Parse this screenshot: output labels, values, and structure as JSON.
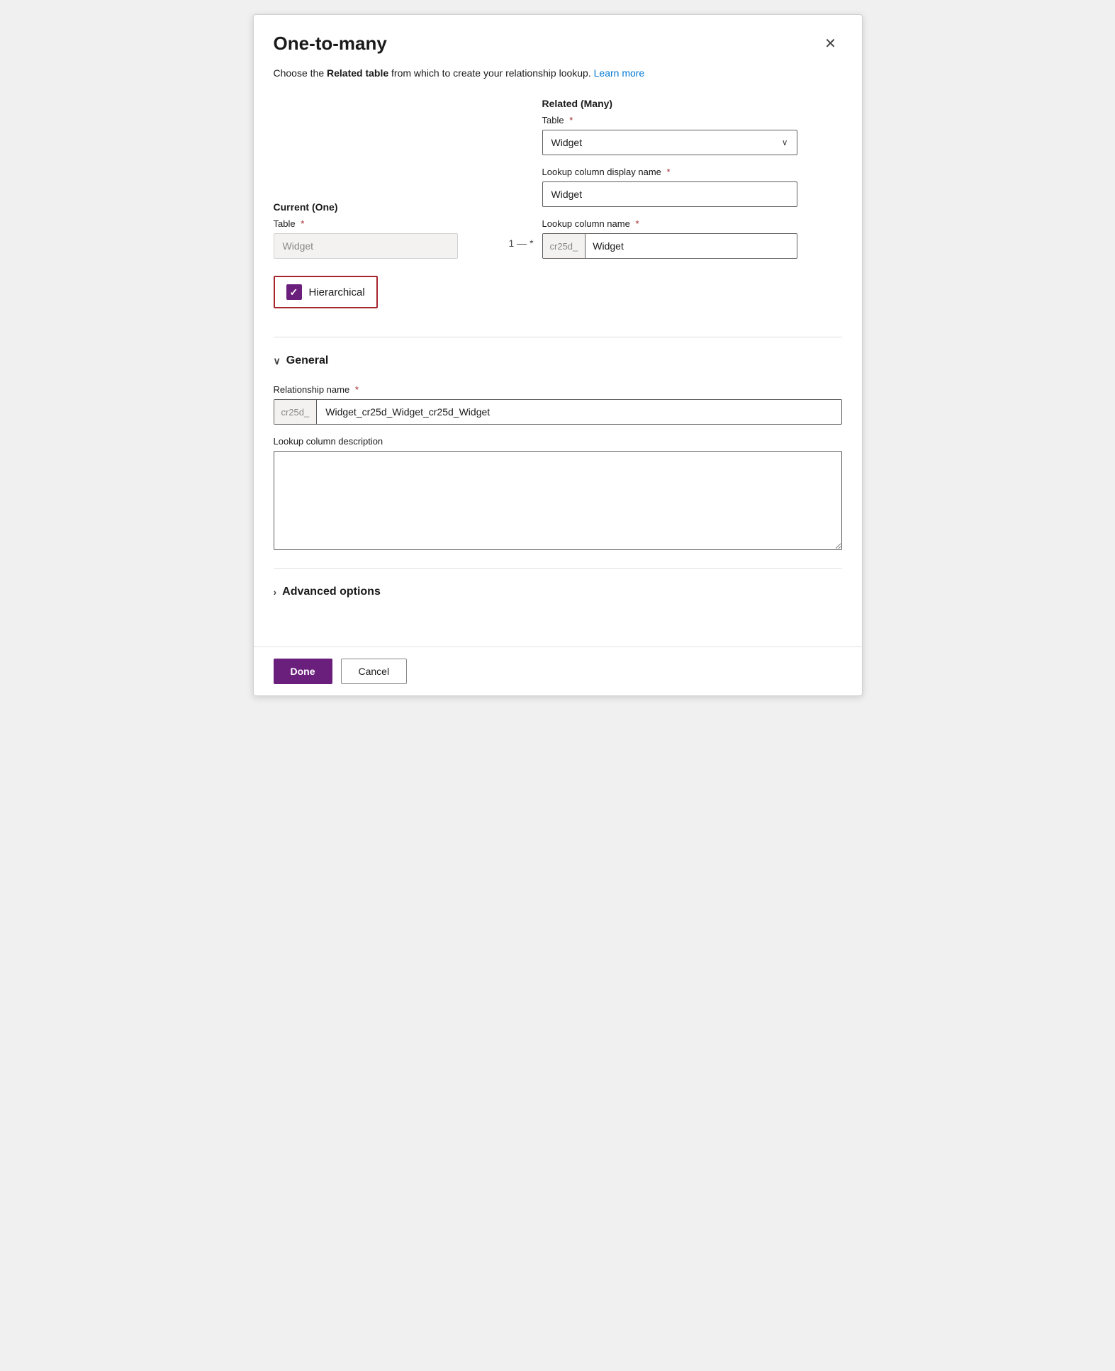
{
  "dialog": {
    "title": "One-to-many",
    "close_label": "×"
  },
  "description": {
    "text_before": "Choose the ",
    "bold_text": "Related table",
    "text_after": " from which to create your relationship lookup. ",
    "link_text": "Learn more",
    "link_href": "#"
  },
  "current_one": {
    "section_label": "Current (One)",
    "table_label": "Table",
    "required": "*",
    "table_value": "Widget"
  },
  "connector": {
    "text": "1 — *"
  },
  "related_many": {
    "section_label": "Related (Many)",
    "table_label": "Table",
    "required": "*",
    "table_value": "Widget",
    "lookup_display_label": "Lookup column display name",
    "lookup_display_required": "*",
    "lookup_display_value": "Widget",
    "lookup_name_label": "Lookup column name",
    "lookup_name_required": "*",
    "lookup_name_prefix": "cr25d_",
    "lookup_name_value": "Widget"
  },
  "hierarchical": {
    "label": "Hierarchical",
    "checked": true
  },
  "general_section": {
    "header": "General",
    "chevron": "∨",
    "relationship_name_label": "Relationship name",
    "relationship_name_required": "*",
    "relationship_name_prefix": "cr25d_",
    "relationship_name_value": "Widget_cr25d_Widget_cr25d_Widget",
    "description_label": "Lookup column description",
    "description_value": ""
  },
  "advanced_section": {
    "header": "Advanced options",
    "chevron": "›"
  },
  "footer": {
    "done_label": "Done",
    "cancel_label": "Cancel"
  }
}
